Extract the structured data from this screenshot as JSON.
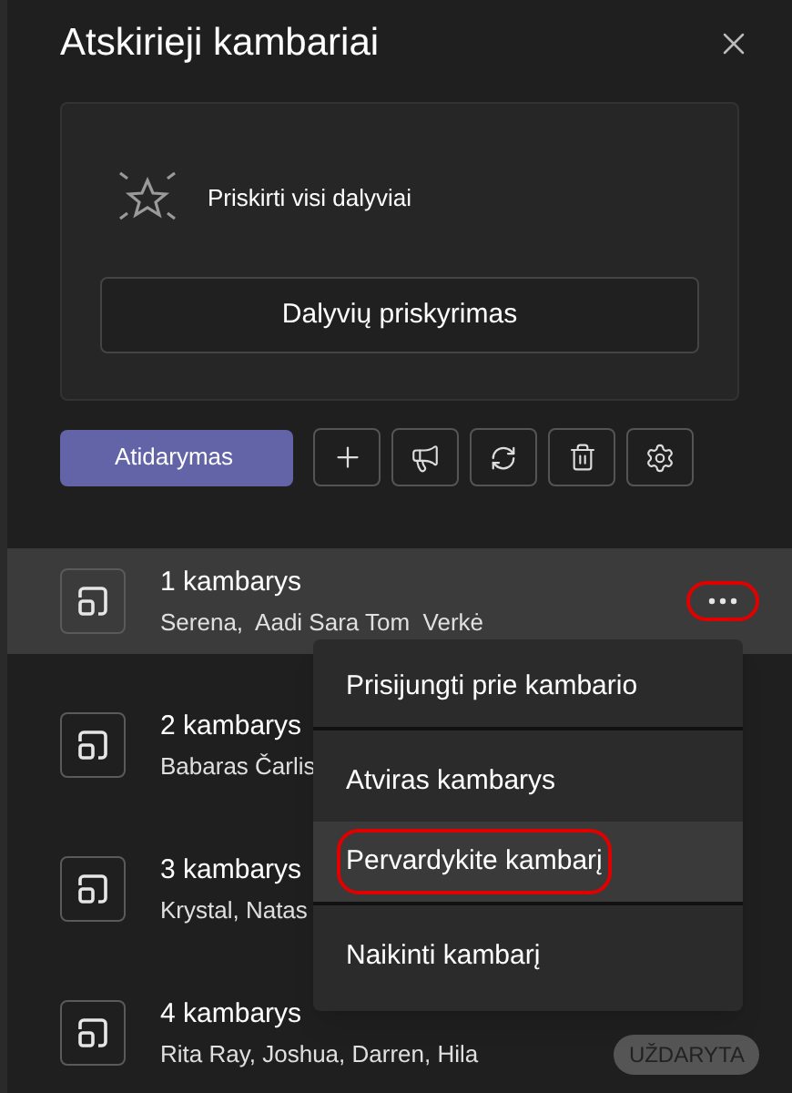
{
  "panel": {
    "title": "Atskirieji kambariai"
  },
  "status_card": {
    "message": "Priskirti visi dalyviai",
    "assign_button": "Dalyvių priskyrimas"
  },
  "toolbar": {
    "open_button": "Atidarymas",
    "icon_buttons": [
      {
        "kind": "add"
      },
      {
        "kind": "announce"
      },
      {
        "kind": "recreate"
      },
      {
        "kind": "delete"
      },
      {
        "kind": "settings"
      }
    ]
  },
  "rooms": [
    {
      "name": "1 kambarys",
      "members": "Serena,  Aadi Sara Tom  Verkė",
      "selected": true,
      "more_highlighted": true
    },
    {
      "name": "2 kambarys",
      "members": "Babaras Čarlis",
      "selected": false
    },
    {
      "name": "3 kambarys",
      "members": "Krystal, Natas",
      "selected": false
    },
    {
      "name": "4 kambarys",
      "members": "Rita Ray, Joshua, Darren, Hila",
      "selected": false,
      "status": "UŽDARYTA"
    }
  ],
  "context_menu": {
    "items": [
      {
        "label": "Prisijungti prie kambario",
        "selected": false,
        "highlighted": false
      },
      {
        "label": "Atviras kambarys",
        "selected": false,
        "highlighted": false
      },
      {
        "label": "Pervardykite kambarį",
        "selected": true,
        "highlighted": true
      },
      {
        "label": "Naikinti kambarį",
        "selected": false,
        "highlighted": false
      }
    ]
  }
}
